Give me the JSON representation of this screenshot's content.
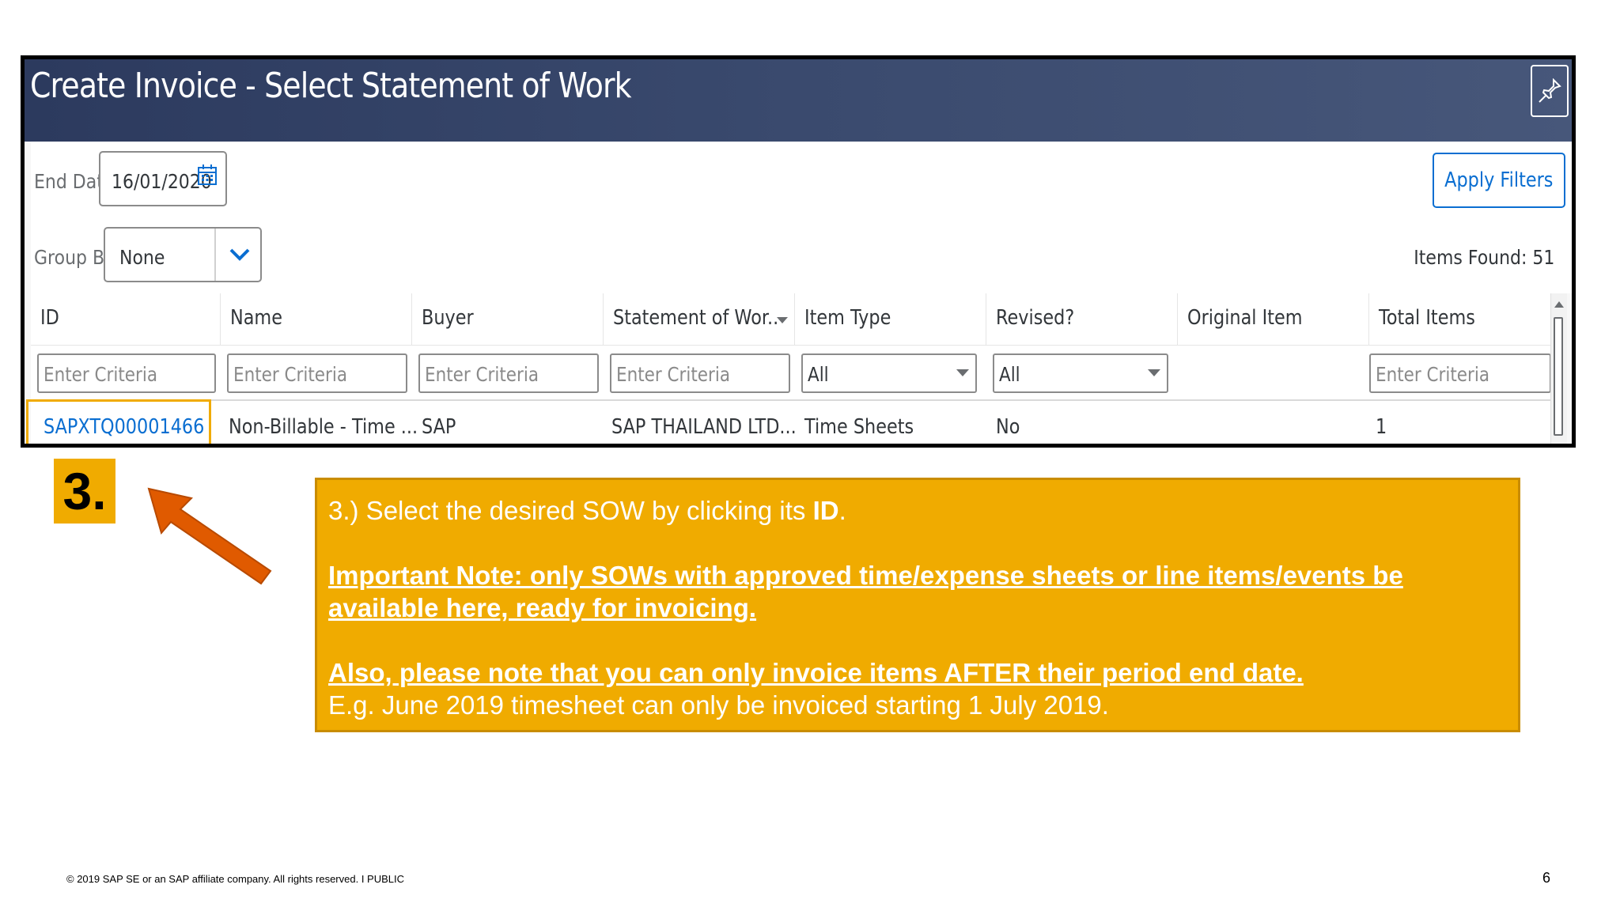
{
  "window": {
    "title": "Create Invoice - Select Statement of Work",
    "pin_icon": "pin-icon"
  },
  "filters": {
    "end_date_label": "End Date",
    "end_date_value": "16/01/2020",
    "calendar_icon": "calendar-icon",
    "apply_label": "Apply Filters",
    "group_by_label": "Group By",
    "group_by_value": "None",
    "chevron_icon": "chevron-down-icon",
    "items_found": "Items Found: 51"
  },
  "table": {
    "columns": [
      "ID",
      "Name",
      "Buyer",
      "Statement of Wor..",
      "Item Type",
      "Revised?",
      "Original Item",
      "Total Items"
    ],
    "sort_icon": "sort-down-icon",
    "criteria_placeholder": "Enter Criteria",
    "item_type_filter": "All",
    "revised_filter": "All",
    "rows": [
      {
        "id": "SAPXTQ00001466",
        "name": "Non-Billable - Time ...",
        "buyer": "SAP",
        "sow": "SAP THAILAND LTD...",
        "item_type": "Time Sheets",
        "revised": "No",
        "original_item": "",
        "total_items": "1"
      }
    ]
  },
  "step": {
    "number": "3",
    "dot": "."
  },
  "callout": {
    "line1_pre": "3.) Select the desired SOW by clicking its ",
    "line1_bold": "ID",
    "line1_post": ".",
    "note1": "Important Note: only SOWs with approved time/expense sheets or line items/events be available here, ready for invoicing.",
    "note2": "Also, please note that you can only invoice items AFTER their period end date.",
    "example": "E.g. June 2019 timesheet can only be invoiced starting 1 July 2019."
  },
  "footer": {
    "copyright": "© 2019 SAP SE or an SAP affiliate company. All rights reserved.   I   PUBLIC",
    "page_number": "6"
  },
  "colors": {
    "header_bg": "#2c3a5e",
    "accent_blue": "#0a6ed1",
    "callout_bg": "#f0ab00",
    "arrow": "#e05a00"
  }
}
